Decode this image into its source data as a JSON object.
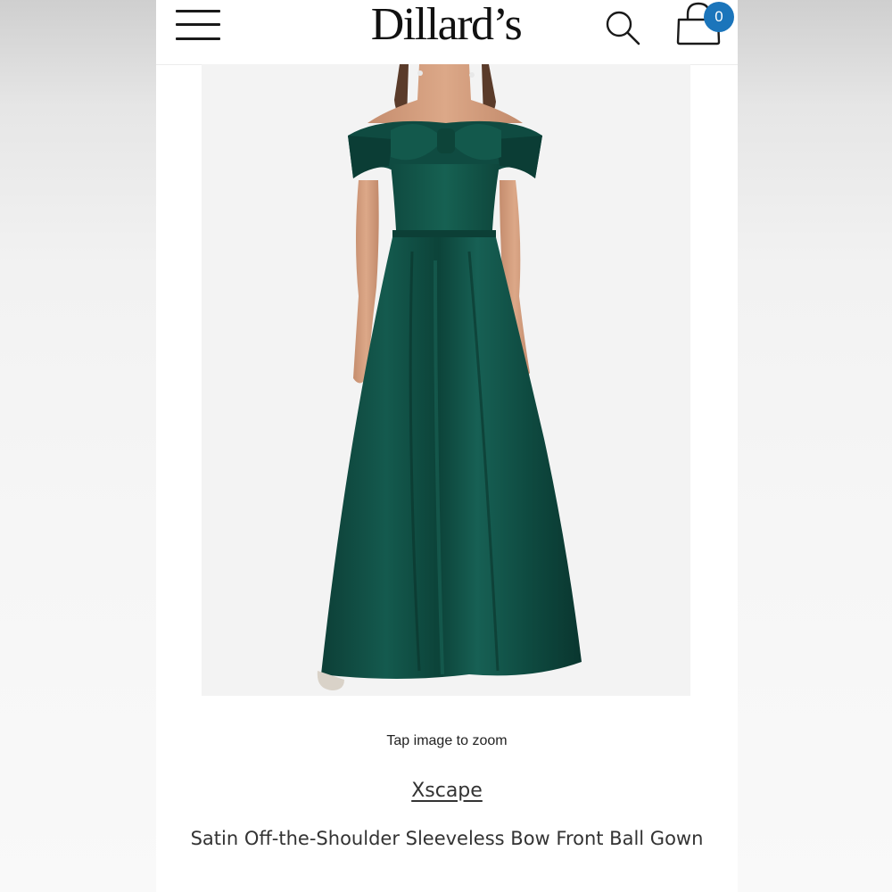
{
  "header": {
    "logo_text": "Dillard’s",
    "bag_count": "0"
  },
  "icons": {
    "menu": "hamburger-menu-icon",
    "search": "search-icon",
    "bag": "shopping-bag-icon"
  },
  "product": {
    "image_alt": "Green satin off-the-shoulder bow front ball gown",
    "zoom_hint": "Tap image to zoom",
    "brand": "Xscape",
    "name": "Satin Off-the-Shoulder Sleeveless Bow Front Ball Gown"
  },
  "colors": {
    "accent": "#1b75bb",
    "gown": "#0f4a40"
  }
}
